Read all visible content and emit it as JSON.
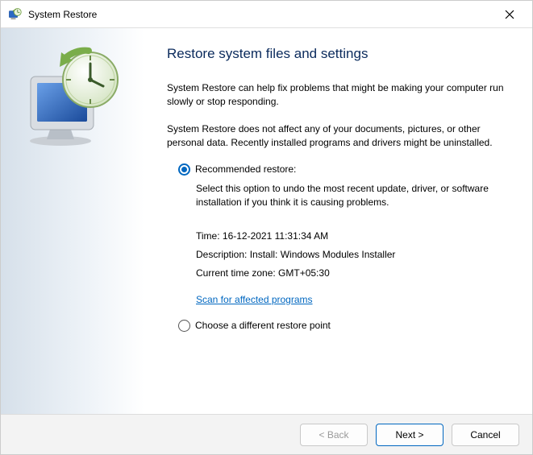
{
  "window": {
    "title": "System Restore"
  },
  "main": {
    "heading": "Restore system files and settings",
    "intro1": "System Restore can help fix problems that might be making your computer run slowly or stop responding.",
    "intro2": "System Restore does not affect any of your documents, pictures, or other personal data. Recently installed programs and drivers might be uninstalled.",
    "option_recommended": {
      "label": "Recommended restore:",
      "desc": "Select this option to undo the most recent update, driver, or software installation if you think it is causing problems.",
      "time": "Time: 16-12-2021 11:31:34 AM",
      "description": "Description: Install: Windows Modules Installer",
      "timezone": "Current time zone: GMT+05:30",
      "scan_link": "Scan for affected programs"
    },
    "option_different": {
      "label": "Choose a different restore point"
    }
  },
  "footer": {
    "back": "< Back",
    "next": "Next >",
    "cancel": "Cancel"
  }
}
